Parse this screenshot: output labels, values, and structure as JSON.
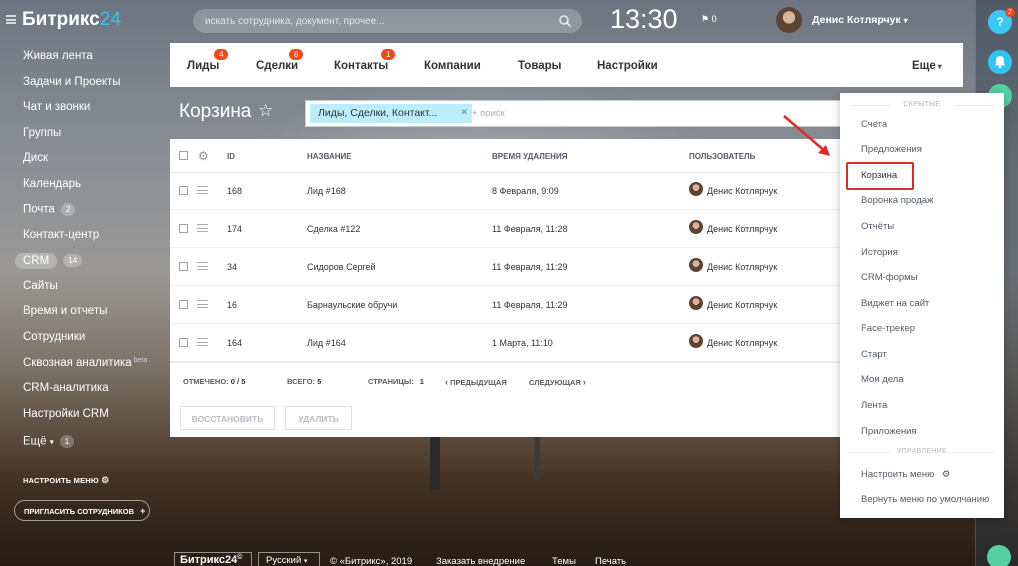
{
  "header": {
    "logo_text": "Битрикс",
    "logo_suffix": "24",
    "search_placeholder": "искать сотрудника, документ, прочее...",
    "time": "13:30",
    "flag_count": "0",
    "user_name": "Денис Котлярчук"
  },
  "sidebar": {
    "items": [
      {
        "label": "Живая лента"
      },
      {
        "label": "Задачи и Проекты"
      },
      {
        "label": "Чат и звонки"
      },
      {
        "label": "Группы"
      },
      {
        "label": "Диск"
      },
      {
        "label": "Календарь"
      },
      {
        "label": "Почта",
        "counter": "2"
      },
      {
        "label": "Контакт-центр"
      },
      {
        "label": "CRM",
        "counter": "14"
      },
      {
        "label": "Сайты"
      },
      {
        "label": "Время и отчеты"
      },
      {
        "label": "Сотрудники"
      },
      {
        "label": "Сквозная аналитика",
        "tag": "beta"
      },
      {
        "label": "CRM-аналитика"
      },
      {
        "label": "Настройки CRM"
      },
      {
        "label": "Ещё",
        "counter": "1"
      }
    ],
    "configure_menu": "НАСТРОИТЬ МЕНЮ",
    "invite": "ПРИГЛАСИТЬ СОТРУДНИКОВ"
  },
  "right_bar": {
    "help_badge": "2"
  },
  "tabs": [
    {
      "label": "Лиды",
      "badge": "4"
    },
    {
      "label": "Сделки",
      "badge": "8"
    },
    {
      "label": "Контакты",
      "badge": "1"
    },
    {
      "label": "Компании"
    },
    {
      "label": "Товары"
    },
    {
      "label": "Настройки"
    }
  ],
  "more_tab": "Еще",
  "page": {
    "title": "Корзина",
    "filter_tag": "Лиды, Сделки, Контакт...",
    "filter_placeholder": "+ поиск"
  },
  "grid": {
    "columns": [
      "ID",
      "НАЗВАНИЕ",
      "ВРЕМЯ УДАЛЕНИЯ",
      "ПОЛЬЗОВАТЕЛЬ"
    ],
    "rows": [
      {
        "id": "168",
        "name": "Лид #168",
        "time": "8 Февраля, 9:09",
        "user": "Денис Котлярчук"
      },
      {
        "id": "174",
        "name": "Сделка #122",
        "time": "11 Февраля, 11:28",
        "user": "Денис Котлярчук"
      },
      {
        "id": "34",
        "name": "Сидоров Сергей",
        "time": "11 Февраля, 11:29",
        "user": "Денис Котлярчук"
      },
      {
        "id": "16",
        "name": "Барнаульские обручи",
        "time": "11 Февраля, 11:29",
        "user": "Денис Котлярчук"
      },
      {
        "id": "164",
        "name": "Лид #164",
        "time": "1 Марта, 11:10",
        "user": "Денис Котлярчук"
      }
    ],
    "footer": {
      "selected_label": "ОТМЕЧЕНО:",
      "selected_value": "0 / 5",
      "total_label": "ВСЕГО:",
      "total_value": "5",
      "pages_label": "СТРАНИЦЫ:",
      "pages_value": "1",
      "prev": "ПРЕДЫДУЩАЯ",
      "next": "СЛЕДУЮЩАЯ"
    },
    "buttons": {
      "restore": "ВОССТАНОВИТЬ",
      "delete": "УДАЛИТЬ"
    }
  },
  "dropdown": {
    "hidden_section": "СКРЫТЫЕ",
    "items": [
      "Счета",
      "Предложения",
      "Корзина",
      "Воронка продаж",
      "Отчёты",
      "История",
      "CRM-формы",
      "Виджет на сайт",
      "Face-трекер",
      "Старт",
      "Мои дела",
      "Лента",
      "Приложения"
    ],
    "manage_section": "УПРАВЛЕНИЕ",
    "configure": "Настроить меню",
    "reset": "Вернуть меню по умолчанию"
  },
  "footer": {
    "logo": "Битрикс24",
    "logo_mark": "©",
    "language": "Русский",
    "copyright": "© «Битрикс», 2019",
    "order": "Заказать внедрение",
    "themes": "Темы",
    "print": "Печать"
  },
  "colors": {
    "accent_blue": "#2fc6f6",
    "badge_red": "#f54819",
    "link_blue": "#2067b0",
    "highlight_red": "#e02a2a",
    "filter_tag_bg": "#bcedfc"
  }
}
